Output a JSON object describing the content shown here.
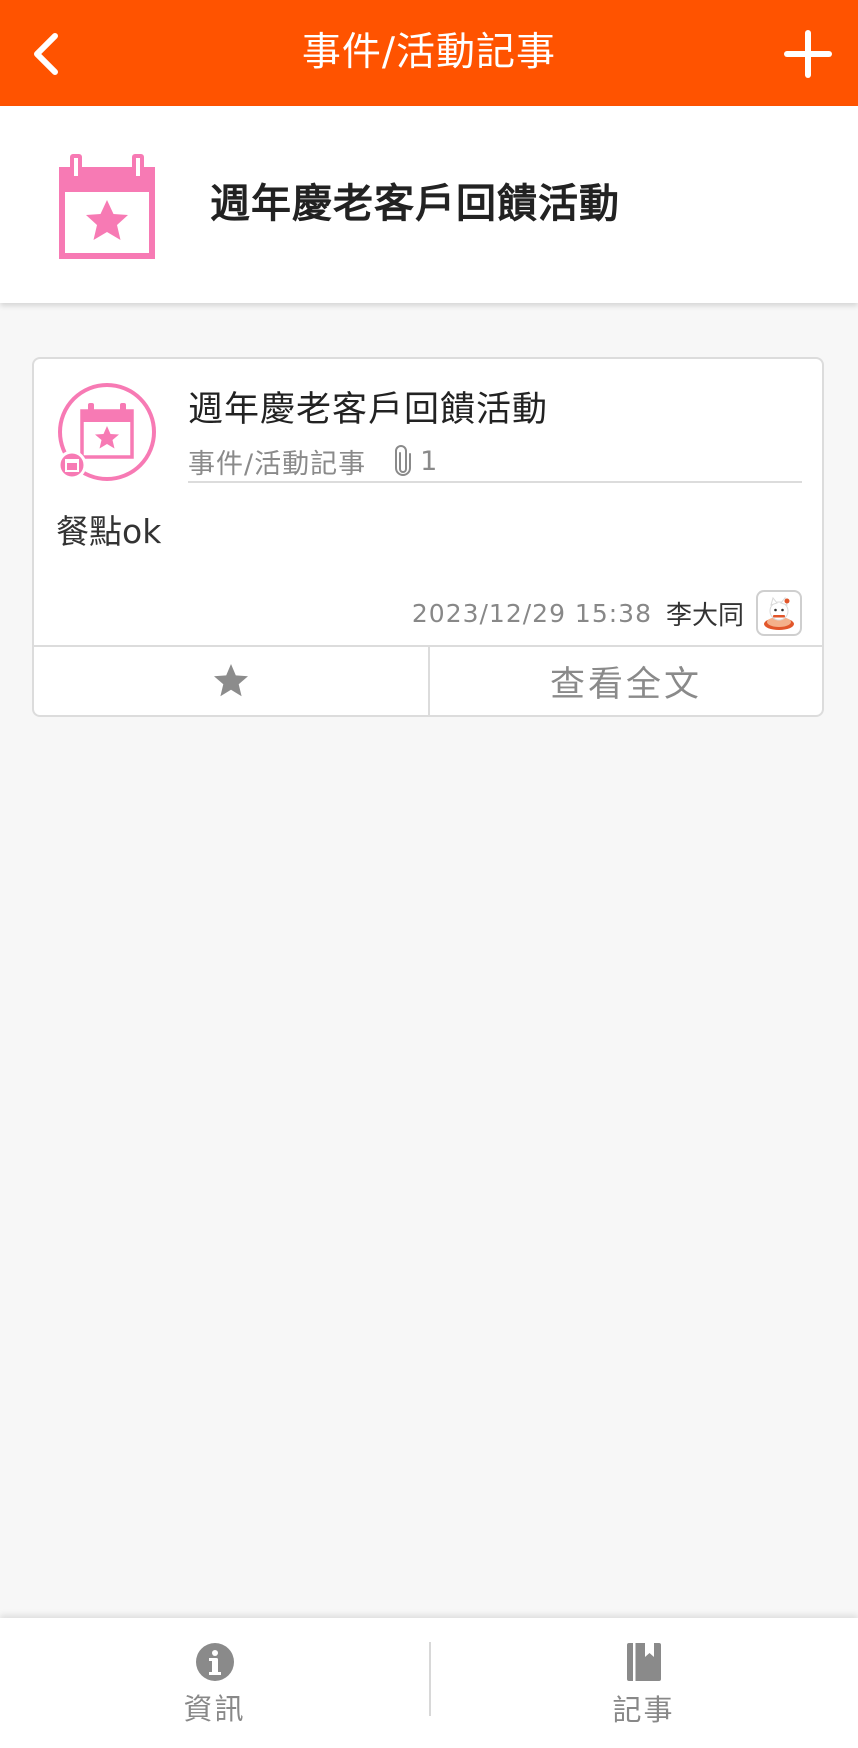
{
  "topbar": {
    "title": "事件/活動記事",
    "back_icon": "chevron-left-icon",
    "add_icon": "plus-icon",
    "color": "#ff5300"
  },
  "header": {
    "title": "週年慶老客戶回饋活動",
    "icon": "calendar-star-icon",
    "icon_color": "#f77ab4"
  },
  "note": {
    "title": "週年慶老客戶回饋活動",
    "category": "事件/活動記事",
    "attachment_count": "1",
    "body": "餐點ok",
    "timestamp": "2023/12/29 15:38",
    "author": "李大同",
    "favorite_icon": "star-icon",
    "read_more_label": "查看全文"
  },
  "bottom_nav": {
    "items": [
      {
        "label": "資訊",
        "icon": "info-icon"
      },
      {
        "label": "記事",
        "icon": "notebook-icon"
      }
    ]
  }
}
